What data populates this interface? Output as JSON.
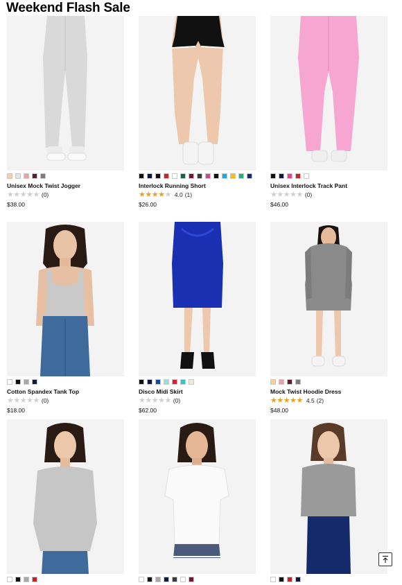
{
  "page": {
    "title": "Weekend Flash Sale"
  },
  "products": [
    {
      "name": "Unisex Mock Twist Jogger",
      "price": "$38.00",
      "rating": null,
      "reviews": "(0)",
      "stars": 0,
      "swatches": [
        "#f5cfa0",
        "#e6e6e6",
        "#e6a4a6",
        "#5a1e2c",
        "#7d7d7d"
      ]
    },
    {
      "name": "Interlock Running Short",
      "price": "$26.00",
      "rating": "4.0",
      "reviews": "(1)",
      "stars": 4,
      "swatches": [
        "#111111",
        "#0d1a3a",
        "#111111",
        "#c0272d",
        "#ffffff",
        "#1f5e4a",
        "#7a1530",
        "#3a3a3a",
        "#c94a8a",
        "#111111",
        "#20a8d8",
        "#f0c020",
        "#20b080",
        "#1a2a6a"
      ]
    },
    {
      "name": "Unisex Interlock Track Pant",
      "price": "$46.00",
      "rating": null,
      "reviews": "(0)",
      "stars": 0,
      "swatches": [
        "#111111",
        "#0d1a3a",
        "#e8409a",
        "#c0272d",
        "#ffffff"
      ]
    },
    {
      "name": "Cotton Spandex Tank Top",
      "price": "$18.00",
      "rating": null,
      "reviews": "(0)",
      "stars": 0,
      "swatches": [
        "#ffffff",
        "#111111",
        "#a8a8a8",
        "#0d1a3a"
      ]
    },
    {
      "name": "Disco Midi Skirt",
      "price": "$62.00",
      "rating": null,
      "reviews": "(0)",
      "stars": 0,
      "swatches": [
        "#111111",
        "#0d1a3a",
        "#1a4aa0",
        "#a0d8e0",
        "#d8203a",
        "#30c8c0",
        "#f2ead8"
      ]
    },
    {
      "name": "Mock Twist Hoodie Dress",
      "price": "$48.00",
      "rating": "4.5",
      "reviews": "(2)",
      "stars": 4.5,
      "swatches": [
        "#f5cfa0",
        "#e6a4a6",
        "#5a1e2c",
        "#7d7d7d"
      ]
    },
    {
      "name": "",
      "price": "",
      "rating": null,
      "reviews": "",
      "stars": 0,
      "swatches": [
        "#ffffff",
        "#111111",
        "#a8a8a8",
        "#c0272d"
      ]
    },
    {
      "name": "",
      "price": "",
      "rating": null,
      "reviews": "",
      "stars": 0,
      "swatches": [
        "#ffffff",
        "#111111",
        "#a8a8a8",
        "#0d1a3a",
        "#3a3a3a",
        "#ffffff",
        "#7a1530"
      ]
    },
    {
      "name": "",
      "price": "",
      "rating": null,
      "reviews": "",
      "stars": 0,
      "swatches": [
        "#ffffff",
        "#111111",
        "#c0272d",
        "#0d1a3a"
      ]
    }
  ],
  "icons": {
    "back_to_top": "arrow-up-to-line-icon"
  }
}
